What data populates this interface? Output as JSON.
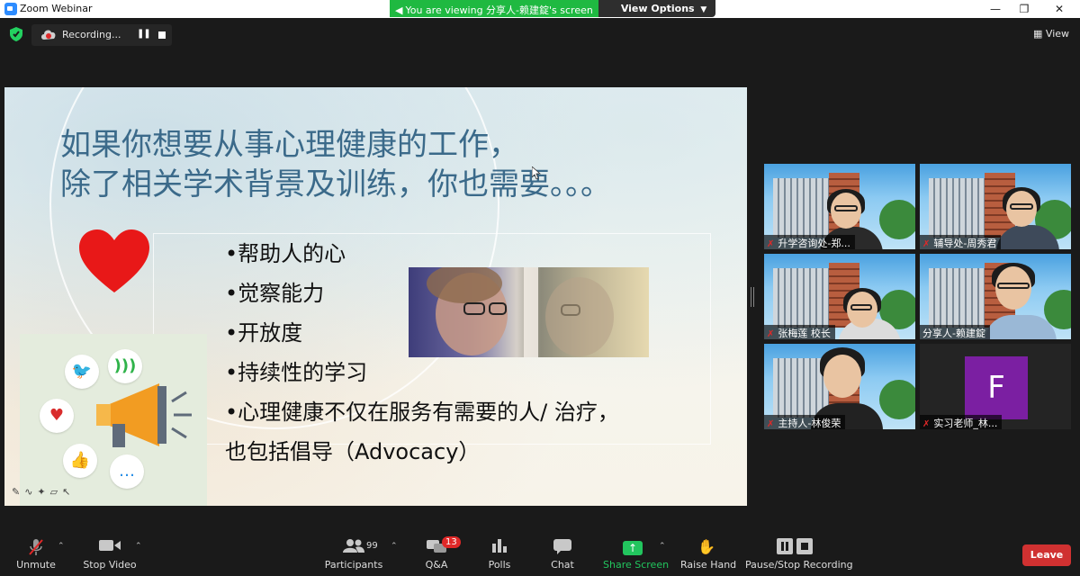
{
  "window": {
    "title": "Zoom Webinar",
    "minimize": "—",
    "restore": "❐",
    "close": "✕"
  },
  "share_banner": {
    "text": "You are viewing 分享人-赖建錠's screen",
    "view_options": "View Options"
  },
  "recording": {
    "label": "Recording..."
  },
  "view_button": "View",
  "slide": {
    "title_line1": "如果你想要从事心理健康的工作，",
    "title_line2": "除了相关学术背景及训练，你也需要。。。",
    "bullets": [
      "•帮助人的心",
      "•觉察能力",
      "•开放度",
      "•持续性的学习",
      "•心理健康不仅在服务有需要的人/ 治疗，",
      "也包括倡导（Advocacy）"
    ]
  },
  "participants_video": [
    {
      "name": "升学咨询处-郑..."
    },
    {
      "name": "辅导处-周秀君"
    },
    {
      "name": "张梅莲 校长"
    },
    {
      "name": "分享人-赖建錠"
    },
    {
      "name": "主持人-林俊荣"
    },
    {
      "name": "实习老师_林...",
      "avatar_letter": "F"
    }
  ],
  "toolbar": {
    "unmute": "Unmute",
    "stop_video": "Stop Video",
    "participants": "Participants",
    "participants_count": "99",
    "qa": "Q&A",
    "qa_badge": "13",
    "polls": "Polls",
    "chat": "Chat",
    "share_screen": "Share Screen",
    "raise_hand": "Raise Hand",
    "pause_stop_recording": "Pause/Stop Recording",
    "leave": "Leave"
  },
  "colors": {
    "share_green": "#1fb941",
    "leave_red": "#d03131",
    "active_speaker_outline": "#e5e05a",
    "avatar_purple": "#7b1fa2"
  }
}
